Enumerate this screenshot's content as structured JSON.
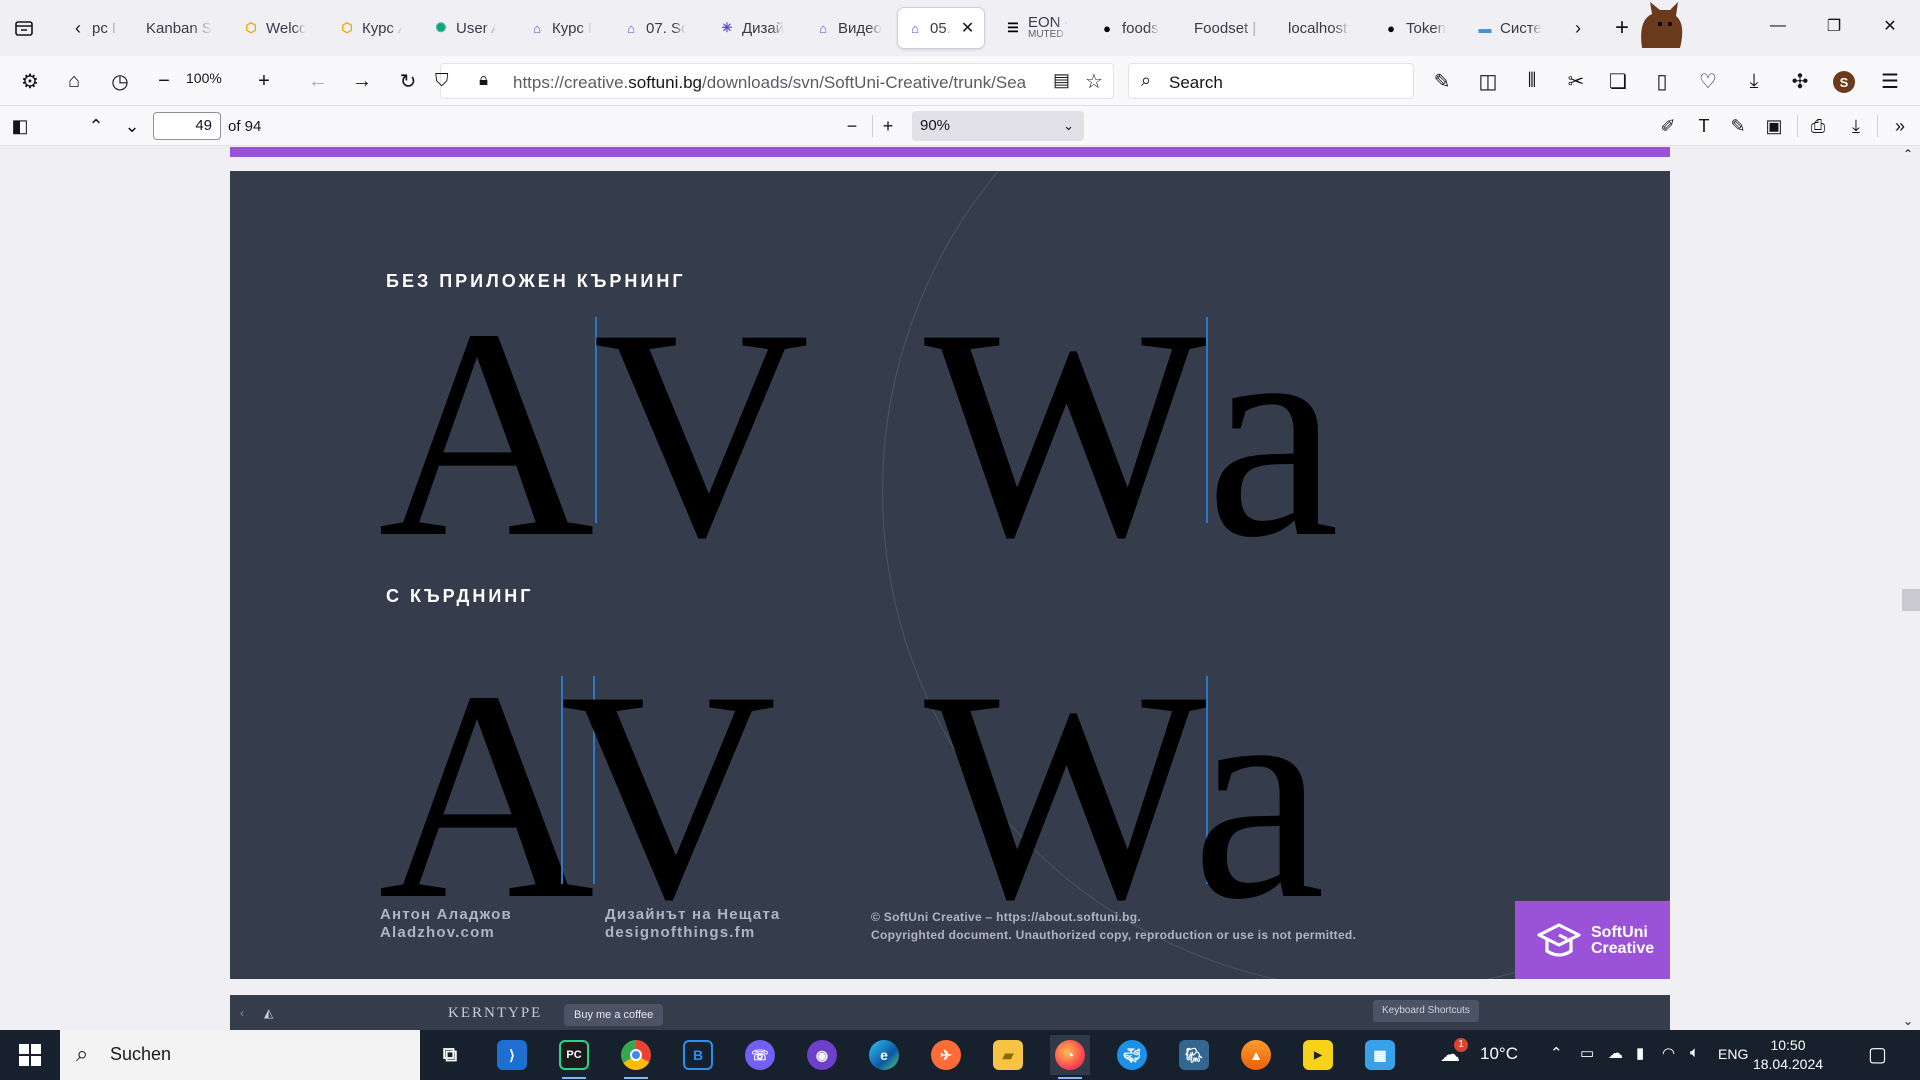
{
  "browser": {
    "tabs": [
      {
        "label": "рс Г",
        "icon": "book-icon",
        "color": "#555"
      },
      {
        "label": "Kanban S",
        "icon": "",
        "color": ""
      },
      {
        "label": "Welco",
        "icon": "hexagon-icon",
        "color": "#f0a500"
      },
      {
        "label": "Курс А",
        "icon": "hexagon-icon",
        "color": "#f0a500"
      },
      {
        "label": "User A",
        "icon": "openai-icon",
        "color": "#10a37f"
      },
      {
        "label": "Курс Г",
        "icon": "graduation-cap-icon",
        "color": "#7b3fc4"
      },
      {
        "label": "07. So",
        "icon": "graduation-cap-icon",
        "color": "#7b3fc4"
      },
      {
        "label": "Дизай",
        "icon": "asterisk-icon",
        "color": "#5a4fcf"
      },
      {
        "label": "Видео",
        "icon": "graduation-cap-icon",
        "color": "#7b3fc4"
      },
      {
        "label": "05.",
        "icon": "graduation-cap-icon",
        "color": "#7b3fc4",
        "active": true
      },
      {
        "label": "EON -",
        "sublabel": "MUTED",
        "icon": "eon-icon",
        "color": "#000"
      },
      {
        "label": "foods",
        "icon": "github-icon",
        "color": "#000"
      },
      {
        "label": "Foodset | I",
        "icon": "",
        "color": ""
      },
      {
        "label": "localhost:",
        "icon": "",
        "color": ""
      },
      {
        "label": "Token",
        "icon": "github-icon",
        "color": "#000"
      },
      {
        "label": "Систе",
        "icon": "hunter-icon",
        "color": "#4a90d9"
      }
    ],
    "zoom": "100%",
    "url_prefix": "https://creative.",
    "url_domain": "softuni.bg",
    "url_suffix": "/downloads/svn/SoftUni-Creative/trunk/Sea",
    "search_placeholder": "Search",
    "profile_initial": "S"
  },
  "pdf_toolbar": {
    "page_number": "49",
    "page_count": "of 94",
    "zoom_value": "90%"
  },
  "slide": {
    "label_without": "БЕЗ ПРИЛОЖЕН КЪРНИНГ",
    "label_with": "С КЪРДНИНГ",
    "pair1_a": "A",
    "pair1_b": "V",
    "pair2_a": "W",
    "pair2_b": "a",
    "credit1_line1": "Антон Аладжов",
    "credit1_line2": "Aladzhov.com",
    "credit2_line1": "Дизайнът на Нещата",
    "credit2_line2": "designofthings.fm",
    "copyright_line1": "© SoftUni Creative – https://about.softuni.bg.",
    "copyright_line2": "Copyrighted document. Unauthorized copy, reproduction or use is not permitted.",
    "brand_line1": "SoftUni",
    "brand_line2": "Creative",
    "accent": "#9a53d8",
    "kerning_line_color": "#2c78c4"
  },
  "next_page": {
    "kerntype": "KERNTYPE",
    "buy_coffee": "Buy me a coffee",
    "keyboard_shortcuts": "Keyboard Shortcuts"
  },
  "taskbar": {
    "search_placeholder": "Suchen",
    "apps": [
      "task-view",
      "vscode",
      "pycharm",
      "chrome",
      "bluestacks",
      "viber",
      "github-desktop",
      "edge",
      "postman",
      "file-explorer",
      "firefox",
      "docker",
      "pgadmin",
      "vlc",
      "kmplayer",
      "hyperv"
    ],
    "temperature": "10°C",
    "language": "ENG",
    "time": "10:50",
    "date": "18.04.2024",
    "weather_badge": "1"
  }
}
